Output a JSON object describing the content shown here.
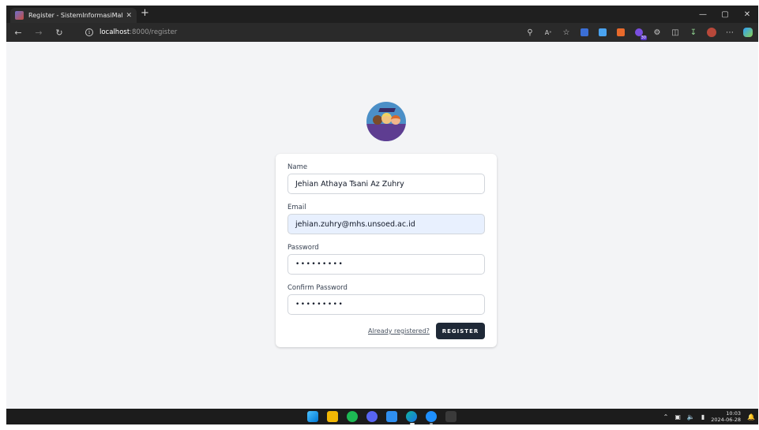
{
  "browser": {
    "tab_title": "Register - SistemInformasiMahas",
    "tab_close": "✕",
    "new_tab": "+",
    "url_host": "localhost",
    "url_path": ":8000/register",
    "window_controls": [
      "—",
      "▢",
      "✕"
    ]
  },
  "page": {
    "form": {
      "name_label": "Name",
      "name_value": "Jehian Athaya Tsani Az Zuhry",
      "email_label": "Email",
      "email_value": "jehian.zuhry@mhs.unsoed.ac.id",
      "password_label": "Password",
      "password_value": "•••••••••",
      "confirm_label": "Confirm Password",
      "confirm_value": "•••••••••",
      "already_registered": "Already registered?",
      "register_button": "REGISTER"
    }
  },
  "taskbar": {
    "time": "10:03",
    "date": "2024-06-28"
  },
  "colors": {
    "page_bg": "#f3f4f6",
    "button_bg": "#1f2937",
    "autofill_bg": "#e8f0fe"
  }
}
